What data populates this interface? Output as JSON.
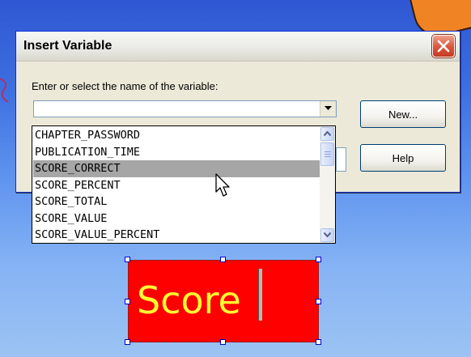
{
  "dialog": {
    "title": "Insert Variable",
    "prompt": "Enter or select the name of the variable:",
    "input_value": "",
    "buttons": {
      "new": "New...",
      "help": "Help"
    }
  },
  "variables": [
    "CHAPTER_PASSWORD",
    "PUBLICATION_TIME",
    "SCORE_CORRECT",
    "SCORE_PERCENT",
    "SCORE_TOTAL",
    "SCORE_VALUE",
    "SCORE_VALUE_PERCENT"
  ],
  "selected_variable": "SCORE_CORRECT",
  "score_box": {
    "text": "Score"
  },
  "icons": {
    "close": "close-icon",
    "dropdown": "chevron-down-icon",
    "scroll_up": "scroll-up-icon",
    "scroll_down": "scroll-down-icon",
    "cursor": "mouse-pointer-icon"
  },
  "colors": {
    "background_top": "#2f57d3",
    "background_bottom": "#9cc3f3",
    "score_fill": "#ff0000",
    "score_text": "#ffff33",
    "selection": "#a6a6a6"
  }
}
